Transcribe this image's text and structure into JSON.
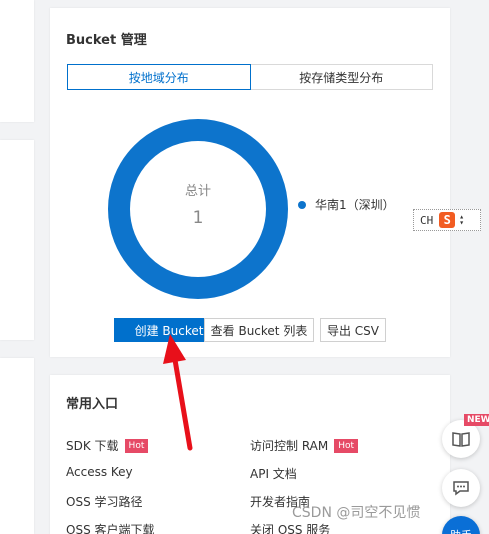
{
  "bucket_panel": {
    "title": "Bucket 管理",
    "tabs": [
      {
        "label": "按地域分布",
        "active": true
      },
      {
        "label": "按存储类型分布",
        "active": false
      }
    ],
    "chart": {
      "center_title": "总计",
      "center_value": "1",
      "legend": "华南1（深圳）"
    },
    "buttons": {
      "create": "创建 Bucket",
      "list": "查看 Bucket 列表",
      "export": "导出 CSV"
    }
  },
  "chart_data": {
    "type": "pie",
    "categories": [
      "华南1（深圳）"
    ],
    "values": [
      1
    ],
    "colors": [
      "#0d74cc"
    ],
    "legend_position": "right"
  },
  "entry_panel": {
    "title": "常用入口",
    "items": [
      {
        "label": "SDK 下载",
        "badge": "Hot"
      },
      {
        "label": "访问控制 RAM",
        "badge": "Hot"
      },
      {
        "label": "Access Key"
      },
      {
        "label": "API 文档"
      },
      {
        "label": "OSS 学习路径"
      },
      {
        "label": "开发者指南"
      },
      {
        "label": "OSS 客户端下载"
      },
      {
        "label": "关闭 OSS 服务"
      }
    ]
  },
  "ime": {
    "lang": "CH",
    "logo": "S"
  },
  "floating": {
    "new_badge": "NEW",
    "assistant": "助手"
  },
  "watermark": "CSDN @司空不见惯",
  "colors": {
    "primary": "#0070cc",
    "donut": "#0d74cc",
    "hot": "#e64a66",
    "arrow": "#e8101a"
  }
}
